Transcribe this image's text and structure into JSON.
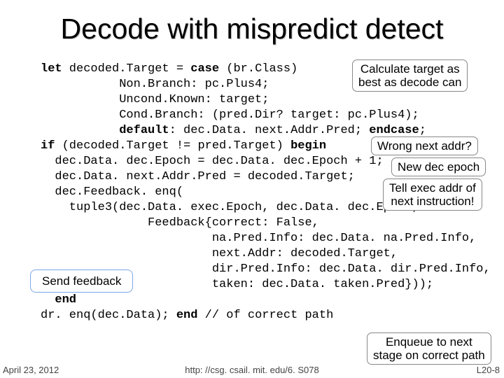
{
  "title": "Decode with mispredict detect",
  "code": {
    "l1a": "let",
    "l1b": " decoded.Target = ",
    "l1c": "case",
    "l1d": " (br.Class)",
    "l2": "           Non.Branch: pc.Plus4;",
    "l3": "           Uncond.Known: target;",
    "l4": "           Cond.Branch: (pred.Dir? target: pc.Plus4);",
    "l5a": "           ",
    "l5b": "default",
    "l5c": ": dec.Data. next.Addr.Pred; ",
    "l5d": "endcase",
    "l5e": ";",
    "l6a": "if",
    "l6b": " (decoded.Target != pred.Target) ",
    "l6c": "begin",
    "l7": "  dec.Data. dec.Epoch = dec.Data. dec.Epoch + 1;",
    "l8": "  dec.Data. next.Addr.Pred = decoded.Target;",
    "l9": "  dec.Feedback. enq(",
    "l10": "    tuple3(dec.Data. exec.Epoch, dec.Data. dec.Epoch,",
    "l11": "               Feedback{correct: False,",
    "l12": "                        na.Pred.Info: dec.Data. na.Pred.Info,",
    "l13": "                        next.Addr: decoded.Target,",
    "l14": "                        dir.Pred.Info: dec.Data. dir.Pred.Info,",
    "l15": "                        taken: dec.Data. taken.Pred}));",
    "l16a": "  ",
    "l16b": "end",
    "l17a": "dr. enq(dec.Data); ",
    "l17b": "end",
    "l17c": " // of correct path"
  },
  "callouts": {
    "calc1": "Calculate target as",
    "calc2": "best as decode can",
    "wrong": "Wrong next addr?",
    "newepoch": "New dec epoch",
    "tell1": "Tell exec addr of",
    "tell2": "next instruction!",
    "send": "Send feedback",
    "enq1": "Enqueue to next",
    "enq2": "stage on correct path"
  },
  "footer": {
    "date": "April 23, 2012",
    "url": "http: //csg. csail. mit. edu/6. S078",
    "page": "L20-8"
  }
}
